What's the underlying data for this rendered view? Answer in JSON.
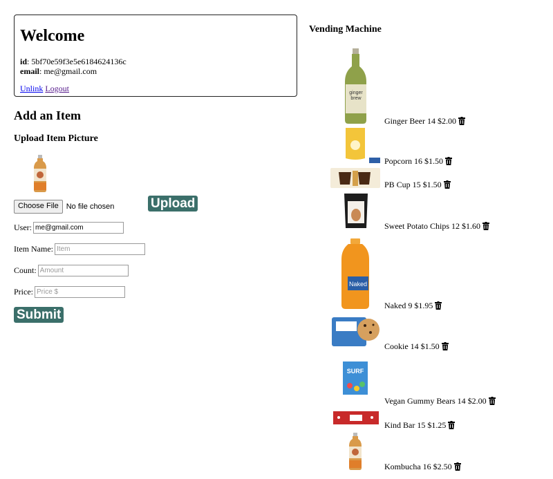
{
  "welcome": {
    "title": "Welcome",
    "id_label": "id",
    "id_value": ": 5bf70e59f3e5e6184624136c",
    "email_label": "email",
    "email_value": ": me@gmail.com",
    "unlink": "Unlink",
    "logout": "Logout"
  },
  "add_item": {
    "title": "Add an Item",
    "upload_title": "Upload Item Picture",
    "choose_file": "Choose File",
    "no_file": "No file chosen",
    "upload_button": "Upload",
    "user_label": "User:",
    "user_value": "me@gmail.com",
    "item_name_label": "Item Name:",
    "item_name_placeholder": "Item",
    "count_label": "Count:",
    "count_placeholder": "Amount",
    "price_label": "Price:",
    "price_placeholder": "Price $",
    "submit_button": "Submit"
  },
  "vending": {
    "title": "Vending Machine",
    "items": [
      {
        "label": "Ginger Beer 14 $2.00",
        "icon": "ginger-beer-bottle"
      },
      {
        "label": "Popcorn 16 $1.50",
        "icon": "popcorn-bag"
      },
      {
        "label": "PB Cup 15 $1.50",
        "icon": "pb-cup-wrapper"
      },
      {
        "label": "Sweet Potato Chips 12 $1.60",
        "icon": "chips-bag"
      },
      {
        "label": "Naked 9 $1.95",
        "icon": "juice-bottle"
      },
      {
        "label": "Cookie 14 $1.50",
        "icon": "cookie-package"
      },
      {
        "label": "Vegan Gummy Bears 14 $2.00",
        "icon": "gummy-bag"
      },
      {
        "label": "Kind Bar 15 $1.25",
        "icon": "kind-bar"
      },
      {
        "label": "Kombucha 16 $2.50",
        "icon": "kombucha-bottle"
      }
    ]
  },
  "colors": {
    "accent": "#3b6f6a",
    "link": "#0000ee",
    "visited_link": "#551a8b"
  }
}
